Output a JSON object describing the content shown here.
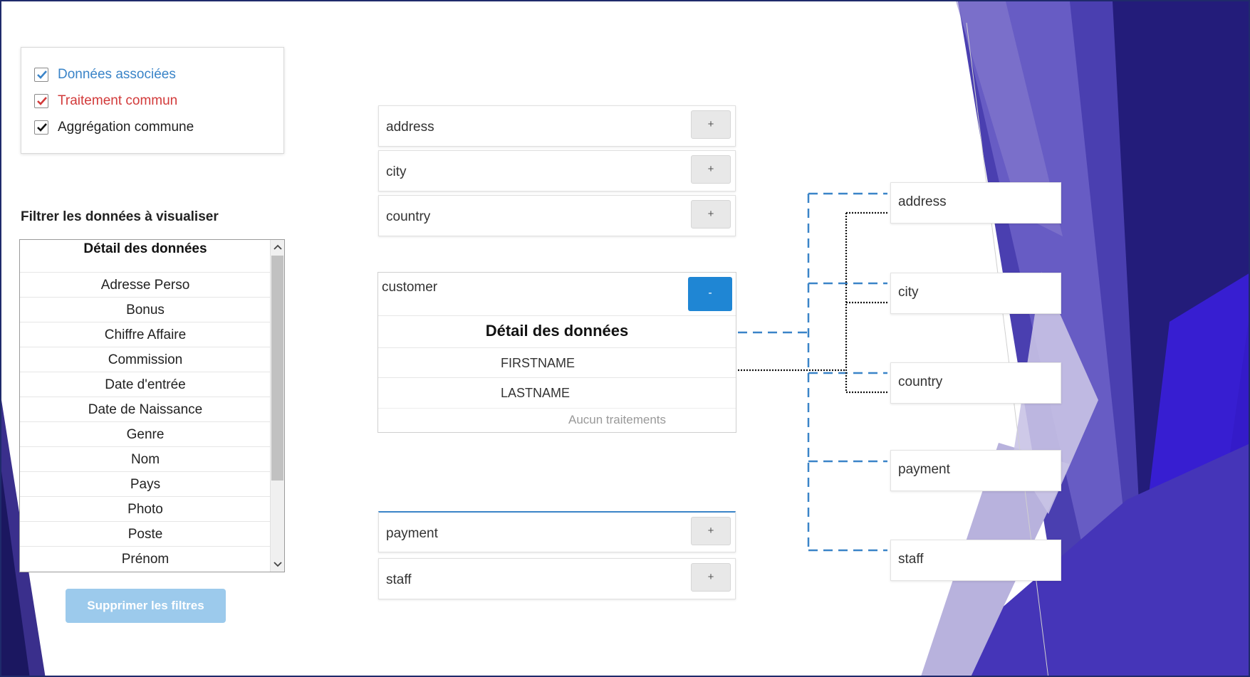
{
  "legend": {
    "items": [
      {
        "label": "Données associées",
        "color": "#3a84c8"
      },
      {
        "label": "Traitement commun",
        "color": "#d23a3a"
      },
      {
        "label": "Aggrégation commune",
        "color": "#222222"
      }
    ]
  },
  "filter": {
    "title": "Filtrer les données à visualiser",
    "list_header": "Détail des données",
    "items": [
      "Adresse Perso",
      "Bonus",
      "Chiffre Affaire",
      "Commission",
      "Date d'entrée",
      "Date de Naissance",
      "Genre",
      "Nom",
      "Pays",
      "Photo",
      "Poste",
      "Prénom"
    ],
    "clear_button": "Supprimer les filtres"
  },
  "tables": {
    "top": [
      {
        "name": "address",
        "action": "+"
      },
      {
        "name": "city",
        "action": "+"
      },
      {
        "name": "country",
        "action": "+"
      }
    ],
    "bottom": [
      {
        "name": "payment",
        "action": "+"
      },
      {
        "name": "staff",
        "action": "+"
      }
    ],
    "customer": {
      "name": "customer",
      "action": "-",
      "detail_title": "Détail des données",
      "fields": [
        "FIRSTNAME",
        "LASTNAME"
      ],
      "empty_text": "Aucun traitements"
    }
  },
  "related": [
    "address",
    "city",
    "country",
    "payment",
    "staff"
  ],
  "colors": {
    "accent": "#1f86d4",
    "link_dashed": "#3a84c8",
    "link_dotted": "#111111",
    "bg_purple_dark": "#1b1760",
    "bg_purple": "#4a3fb0",
    "bg_violet": "#3b1fe0"
  },
  "icons": {
    "checkbox": "checkmark-icon",
    "scroll_up": "chevron-up-icon",
    "scroll_down": "chevron-down-icon"
  }
}
